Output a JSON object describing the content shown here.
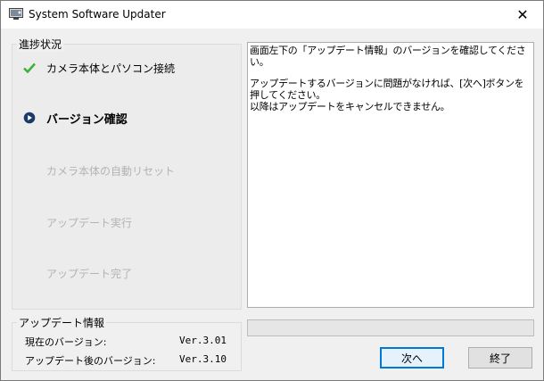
{
  "window": {
    "title": "System Software Updater",
    "close_glyph": "✕"
  },
  "progress": {
    "group_label": "進捗状況",
    "steps": [
      {
        "label": "カメラ本体とパソコン接続",
        "state": "done",
        "icon": "check-icon"
      },
      {
        "label": "バージョン確認",
        "state": "current",
        "icon": "play-circle-icon"
      },
      {
        "label": "カメラ本体の自動リセット",
        "state": "pending",
        "icon": ""
      },
      {
        "label": "アップデート実行",
        "state": "pending",
        "icon": ""
      },
      {
        "label": "アップデート完了",
        "state": "pending",
        "icon": ""
      }
    ]
  },
  "update_info": {
    "group_label": "アップデート情報",
    "current_label": "現在のバージョン:",
    "current_value": "Ver.3.01",
    "after_label": "アップデート後のバージョン:",
    "after_value": "Ver.3.10"
  },
  "message": {
    "line1": "画面左下の「アップデート情報」のバージョンを確認してください。",
    "line2": "アップデートするバージョンに問題がなければ、[次へ]ボタンを押してください。",
    "line3": "以降はアップデートをキャンセルできません。"
  },
  "progress_bar": {
    "value": 0
  },
  "buttons": {
    "next_label": "次へ",
    "exit_label": "終了"
  },
  "colors": {
    "check": "#3cb43c",
    "current_icon": "#1a3a6b",
    "pending_text": "#b3b3b3",
    "default_button_border": "#0078d7"
  }
}
